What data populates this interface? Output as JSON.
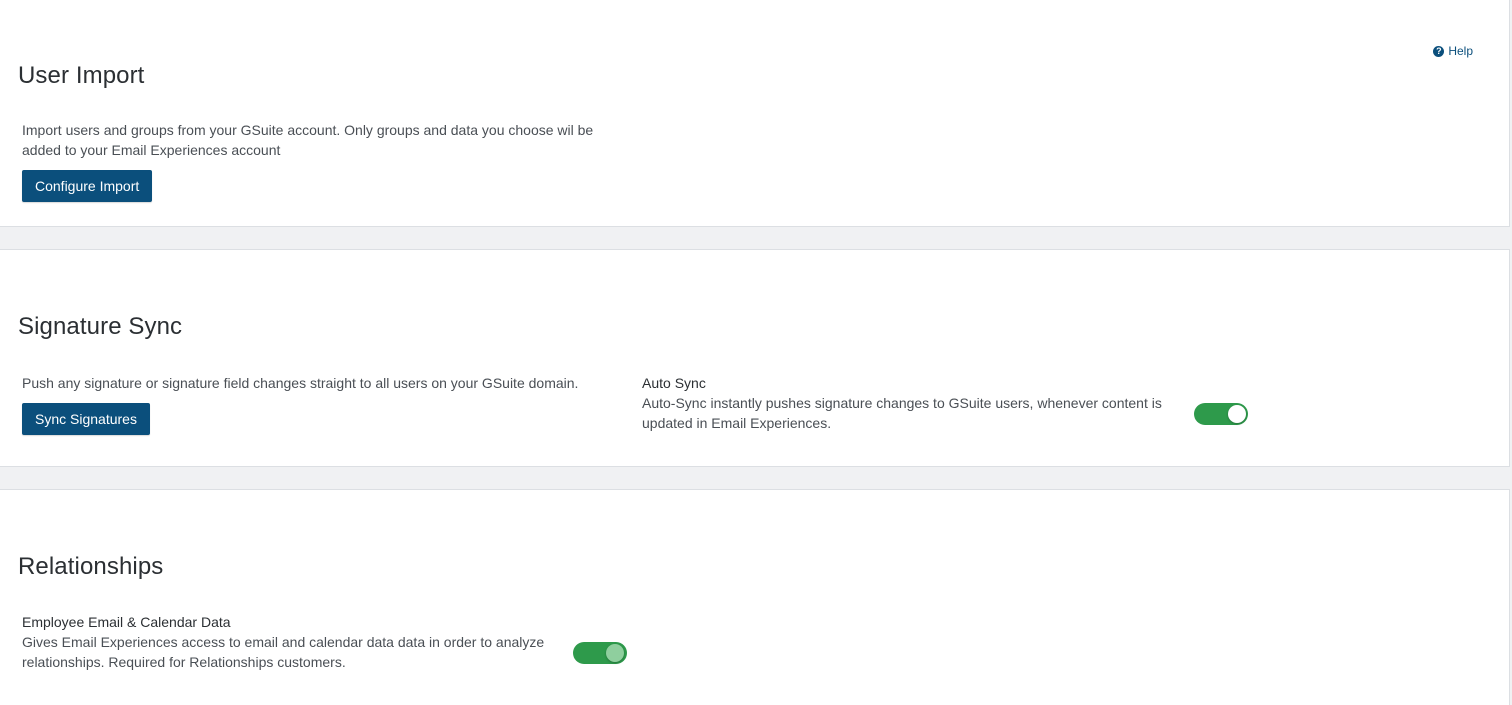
{
  "help": {
    "label": "Help",
    "icon": "question-circle-icon"
  },
  "user_import": {
    "title": "User Import",
    "description_line1": "Import users and groups from your GSuite account. Only groups and data you choose wil be",
    "description_line2": "added to your Email Experiences account",
    "button_label": "Configure Import"
  },
  "signature_sync": {
    "title": "Signature Sync",
    "description": "Push any signature or signature field changes straight to all users on your GSuite domain.",
    "button_label": "Sync Signatures",
    "auto_sync": {
      "label": "Auto Sync",
      "description_line1": "Auto-Sync instantly pushes signature changes to GSuite users, whenever content is",
      "description_line2": "updated in Email Experiences.",
      "enabled": true
    }
  },
  "relationships": {
    "title": "Relationships",
    "setting": {
      "label": "Employee Email & Calendar Data",
      "description_line1": "Gives Email Experiences access to email and calendar data data in order to analyze",
      "description_line2": "relationships. Required for Relationships customers.",
      "enabled": true
    }
  },
  "colors": {
    "page_background": "#f0f1f3",
    "button": "#0b4f7c",
    "toggle_on": "#2e9a4b",
    "link": "#0b4f7c"
  }
}
